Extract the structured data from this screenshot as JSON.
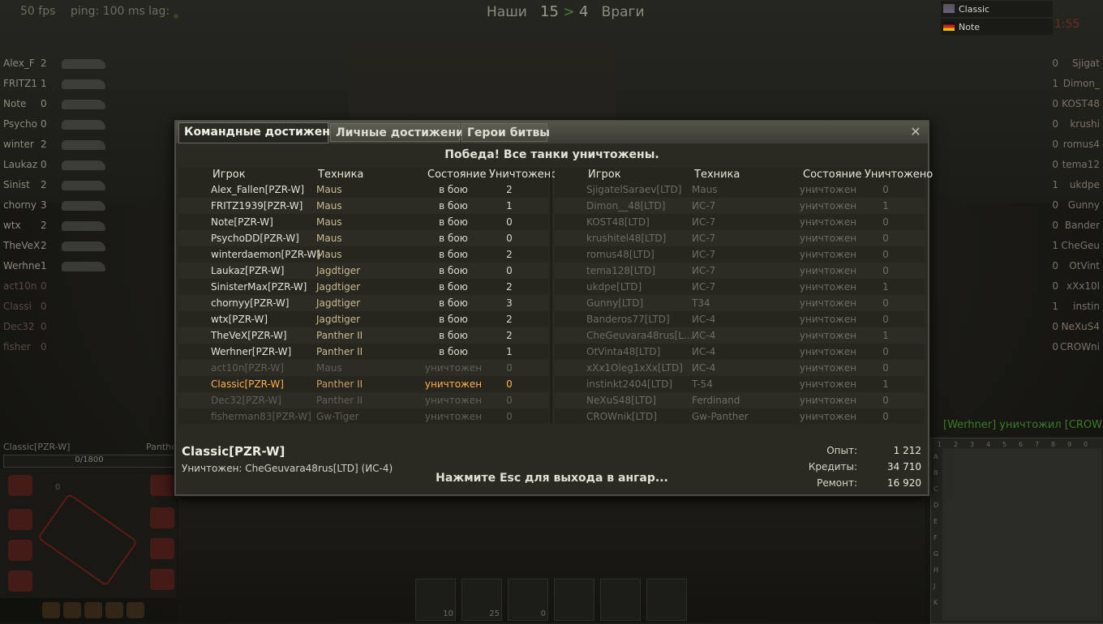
{
  "hud": {
    "fps": "50 fps",
    "ping": "ping: 100 ms",
    "lag": "lag:",
    "score_allies_label": "Наши",
    "score_allies": "15",
    "score_sep": ">",
    "score_enemies": "4",
    "score_enemies_label": "Враги",
    "timer": "1:55"
  },
  "platoon": [
    {
      "name": "Classic"
    },
    {
      "name": "Note"
    }
  ],
  "team_left": [
    {
      "name": "Alex_F",
      "frags": "2"
    },
    {
      "name": "FRITZ1",
      "frags": "1"
    },
    {
      "name": "Note",
      "frags": "0"
    },
    {
      "name": "Psycho",
      "frags": "0"
    },
    {
      "name": "winter",
      "frags": "2"
    },
    {
      "name": "Laukaz",
      "frags": "0"
    },
    {
      "name": "Sinist",
      "frags": "2"
    },
    {
      "name": "chorny",
      "frags": "3"
    },
    {
      "name": "wtx",
      "frags": "2"
    },
    {
      "name": "TheVeX",
      "frags": "2"
    },
    {
      "name": "Werhne",
      "frags": "1"
    },
    {
      "name": "act10n",
      "frags": "0"
    },
    {
      "name": "Classi",
      "frags": "0"
    },
    {
      "name": "Dec32",
      "frags": "0"
    },
    {
      "name": "fisher",
      "frags": "0"
    }
  ],
  "team_right": [
    {
      "name": "Sjigat",
      "frags": "0"
    },
    {
      "name": "Dimon_",
      "frags": "1"
    },
    {
      "name": "KOST48",
      "frags": "0"
    },
    {
      "name": "krushi",
      "frags": "0"
    },
    {
      "name": "romus4",
      "frags": "0"
    },
    {
      "name": "tema12",
      "frags": "0"
    },
    {
      "name": "ukdpe",
      "frags": "1"
    },
    {
      "name": "Gunny",
      "frags": "0"
    },
    {
      "name": "Bander",
      "frags": "0"
    },
    {
      "name": "CheGeu",
      "frags": "1"
    },
    {
      "name": "OtVint",
      "frags": "0"
    },
    {
      "name": "xXx10l",
      "frags": "0"
    },
    {
      "name": "instin",
      "frags": "1"
    },
    {
      "name": "NeXuS4",
      "frags": "0"
    },
    {
      "name": "CROWni",
      "frags": "0"
    }
  ],
  "dialog": {
    "tabs": [
      "Командные достижения",
      "Личные достижения",
      "Герои битвы"
    ],
    "close": "✕",
    "result": "Победа! Все танки уничтожены.",
    "headers": {
      "player": "Игрок",
      "vehicle": "Техника",
      "status": "Состояние",
      "kills": "Уничтожено"
    },
    "allies": [
      {
        "player": "Alex_Fallen[PZR-W]",
        "vehicle": "Maus",
        "status": "в бою",
        "kills": "2"
      },
      {
        "player": "FRITZ1939[PZR-W]",
        "vehicle": "Maus",
        "status": "в бою",
        "kills": "1"
      },
      {
        "player": "Note[PZR-W]",
        "vehicle": "Maus",
        "status": "в бою",
        "kills": "0"
      },
      {
        "player": "PsychoDD[PZR-W]",
        "vehicle": "Maus",
        "status": "в бою",
        "kills": "0"
      },
      {
        "player": "winterdaemon[PZR-W]",
        "vehicle": "Maus",
        "status": "в бою",
        "kills": "2"
      },
      {
        "player": "Laukaz[PZR-W]",
        "vehicle": "Jagdtiger",
        "status": "в бою",
        "kills": "0"
      },
      {
        "player": "SinisterMax[PZR-W]",
        "vehicle": "Jagdtiger",
        "status": "в бою",
        "kills": "2"
      },
      {
        "player": "chornyy[PZR-W]",
        "vehicle": "Jagdtiger",
        "status": "в бою",
        "kills": "3"
      },
      {
        "player": "wtx[PZR-W]",
        "vehicle": "Jagdtiger",
        "status": "в бою",
        "kills": "2"
      },
      {
        "player": "TheVeX[PZR-W]",
        "vehicle": "Panther II",
        "status": "в бою",
        "kills": "2"
      },
      {
        "player": "Werhner[PZR-W]",
        "vehicle": "Panther II",
        "status": "в бою",
        "kills": "1"
      },
      {
        "player": "act10n[PZR-W]",
        "vehicle": "Maus",
        "status": "уничтожен",
        "kills": "0"
      },
      {
        "player": "Classic[PZR-W]",
        "vehicle": "Panther II",
        "status": "уничтожен",
        "kills": "0"
      },
      {
        "player": "Dec32[PZR-W]",
        "vehicle": "Panther II",
        "status": "уничтожен",
        "kills": "0"
      },
      {
        "player": "fisherman83[PZR-W]",
        "vehicle": "Gw-Tiger",
        "status": "уничтожен",
        "kills": "0"
      }
    ],
    "enemies": [
      {
        "player": "SjigatelSaraev[LTD]",
        "vehicle": "Maus",
        "status": "уничтожен",
        "kills": "0"
      },
      {
        "player": "Dimon__48[LTD]",
        "vehicle": "ИС-7",
        "status": "уничтожен",
        "kills": "1"
      },
      {
        "player": "KOST48[LTD]",
        "vehicle": "ИС-7",
        "status": "уничтожен",
        "kills": "0"
      },
      {
        "player": "krushitel48[LTD]",
        "vehicle": "ИС-7",
        "status": "уничтожен",
        "kills": "0"
      },
      {
        "player": "romus48[LTD]",
        "vehicle": "ИС-7",
        "status": "уничтожен",
        "kills": "0"
      },
      {
        "player": "tema128[LTD]",
        "vehicle": "ИС-7",
        "status": "уничтожен",
        "kills": "0"
      },
      {
        "player": "ukdpe[LTD]",
        "vehicle": "ИС-7",
        "status": "уничтожен",
        "kills": "1"
      },
      {
        "player": "Gunny[LTD]",
        "vehicle": "T34",
        "status": "уничтожен",
        "kills": "0"
      },
      {
        "player": "Banderos77[LTD]",
        "vehicle": "ИС-4",
        "status": "уничтожен",
        "kills": "0"
      },
      {
        "player": "CheGeuvara48rus[L...",
        "vehicle": "ИС-4",
        "status": "уничтожен",
        "kills": "1"
      },
      {
        "player": "OtVinta48[LTD]",
        "vehicle": "ИС-4",
        "status": "уничтожен",
        "kills": "0"
      },
      {
        "player": "xXx1Oleg1xXx[LTD]",
        "vehicle": "ИС-4",
        "status": "уничтожен",
        "kills": "0"
      },
      {
        "player": "instinkt2404[LTD]",
        "vehicle": "T-54",
        "status": "уничтожен",
        "kills": "1"
      },
      {
        "player": "NeXuS48[LTD]",
        "vehicle": "Ferdinand",
        "status": "уничтожен",
        "kills": "0"
      },
      {
        "player": "CROWnik[LTD]",
        "vehicle": "Gw-Panther",
        "status": "уничтожен",
        "kills": "0"
      }
    ],
    "self_name": "Classic[PZR-W]",
    "killed_by": "Уничтожен: CheGeuvara48rus[LTD] (ИС-4)",
    "esc_hint": "Нажмите Esc для выхода в ангар...",
    "stats": [
      {
        "label": "Опыт:",
        "value": "1 212"
      },
      {
        "label": "Кредиты:",
        "value": "34 710"
      },
      {
        "label": "Ремонт:",
        "value": "16 920"
      }
    ]
  },
  "player_hud": {
    "vehicle_name": "Classic[PZR-W]",
    "vehicle_type": "Panther",
    "hp": "0/1800",
    "counter": "0"
  },
  "ammo": [
    "10",
    "25",
    "0"
  ],
  "kill_message": "[Werhner] уничтожил [CROWnik]",
  "minimap": {
    "cols": [
      "1",
      "2",
      "3",
      "4",
      "5",
      "6",
      "7",
      "8",
      "9",
      "0"
    ],
    "rows": [
      "A",
      "B",
      "C",
      "D",
      "E",
      "F",
      "G",
      "H",
      "J",
      "K"
    ]
  }
}
